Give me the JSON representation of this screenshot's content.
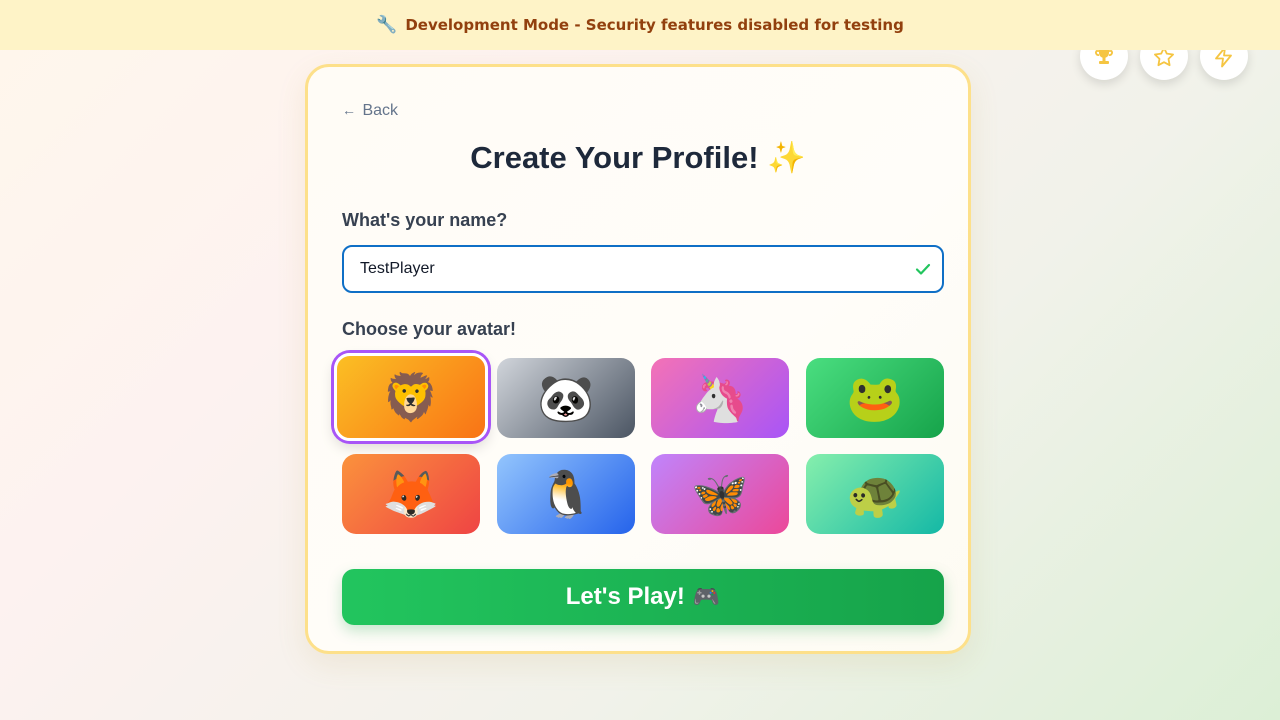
{
  "banner": {
    "icon": "wrench-icon",
    "text": "Development Mode - Security features disabled for testing"
  },
  "corner_buttons": [
    {
      "icon": "trophy-icon",
      "color": "#f5c542"
    },
    {
      "icon": "star-icon",
      "color": "#f5c542"
    },
    {
      "icon": "lightning-icon",
      "color": "#f5c542"
    }
  ],
  "card": {
    "back_label": "Back",
    "title": "Create Your Profile!",
    "title_emoji": "✨",
    "name_label": "What's your name?",
    "name_value": "TestPlayer",
    "name_valid": true,
    "avatar_label": "Choose your avatar!",
    "avatars": [
      {
        "emoji": "🦁",
        "name": "lion",
        "selected": true,
        "gradient": [
          "#fbbf24",
          "#f97316"
        ]
      },
      {
        "emoji": "🐼",
        "name": "panda",
        "selected": false,
        "gradient": [
          "#d1d5db",
          "#4b5563"
        ]
      },
      {
        "emoji": "🦄",
        "name": "unicorn",
        "selected": false,
        "gradient": [
          "#f472b6",
          "#a855f7"
        ]
      },
      {
        "emoji": "🐸",
        "name": "frog",
        "selected": false,
        "gradient": [
          "#4ade80",
          "#16a34a"
        ]
      },
      {
        "emoji": "🦊",
        "name": "fox",
        "selected": false,
        "gradient": [
          "#fb923c",
          "#ef4444"
        ]
      },
      {
        "emoji": "🐧",
        "name": "penguin",
        "selected": false,
        "gradient": [
          "#93c5fd",
          "#2563eb"
        ]
      },
      {
        "emoji": "🦋",
        "name": "butterfly",
        "selected": false,
        "gradient": [
          "#c084fc",
          "#ec4899"
        ]
      },
      {
        "emoji": "🐢",
        "name": "turtle",
        "selected": false,
        "gradient": [
          "#86efac",
          "#14b8a6"
        ]
      }
    ],
    "play_label": "Let's Play!",
    "play_emoji": "🎮"
  },
  "colors": {
    "accent_green": "#22c55e",
    "input_border": "#0f6fc6",
    "selected_ring": "#a855f7",
    "card_border": "#fde08a"
  }
}
